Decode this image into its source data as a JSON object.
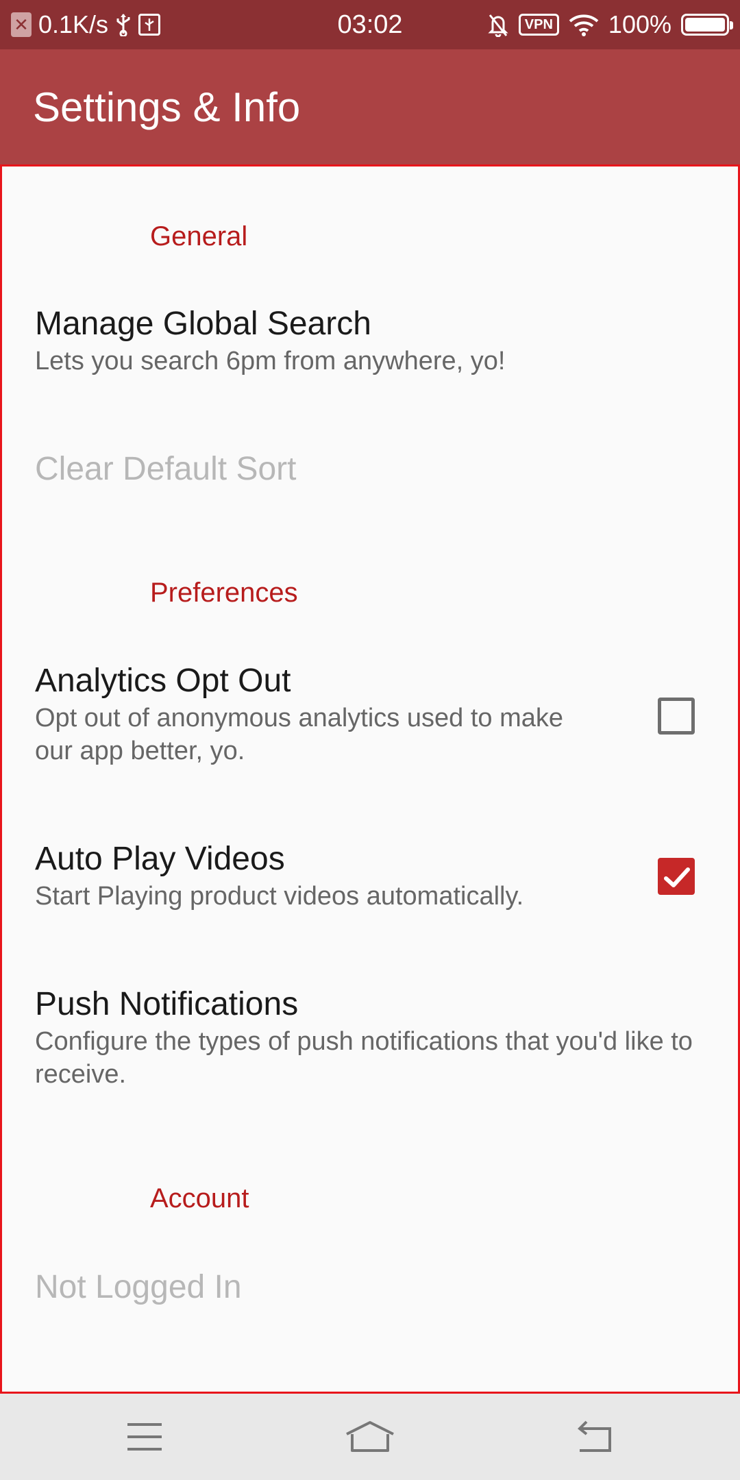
{
  "status_bar": {
    "network_speed": "0.1K/s",
    "time": "03:02",
    "vpn_label": "VPN",
    "battery_percent": "100%",
    "battery_level": 1.0
  },
  "app_bar": {
    "title": "Settings & Info"
  },
  "sections": {
    "general": {
      "header": "General",
      "manage_global_search": {
        "title": "Manage Global Search",
        "summary": "Lets you search 6pm from anywhere, yo!"
      },
      "clear_default_sort": {
        "title": "Clear Default Sort",
        "enabled": false
      }
    },
    "preferences": {
      "header": "Preferences",
      "analytics_opt_out": {
        "title": "Analytics Opt Out",
        "summary": "Opt out of anonymous analytics used to make our app better, yo.",
        "checked": false
      },
      "auto_play_videos": {
        "title": "Auto Play Videos",
        "summary": "Start Playing product videos automatically.",
        "checked": true
      },
      "push_notifications": {
        "title": "Push Notifications",
        "summary": "Configure the types of push notifications that you'd like to receive."
      }
    },
    "account": {
      "header": "Account",
      "login_status": {
        "title": "Not Logged In",
        "enabled": false
      }
    }
  },
  "colors": {
    "status_bar": "#8b3033",
    "app_bar": "#ab4244",
    "accent": "#c62828",
    "category_text": "#b71c1c",
    "highlight_border": "#e8151b"
  },
  "navigation_bar": {
    "icons": [
      "menu-icon",
      "home-icon",
      "back-icon"
    ]
  }
}
